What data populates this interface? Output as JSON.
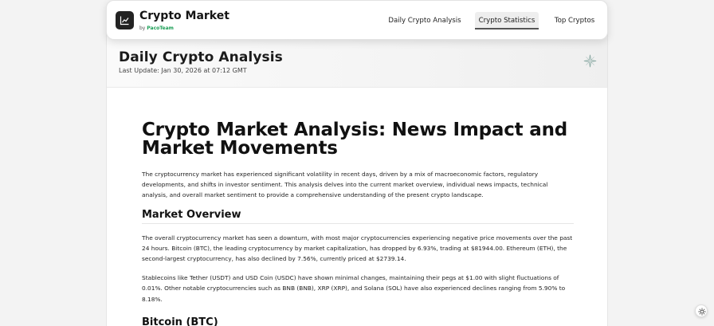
{
  "header": {
    "brand": "Crypto Market",
    "byline_prefix": "by",
    "byline_team": "PacoTeam",
    "logo_icon": "chart-line-icon",
    "nav": [
      {
        "label": "Daily Crypto Analysis",
        "active": false
      },
      {
        "label": "Crypto Statistics",
        "active": true
      },
      {
        "label": "Top Cryptos",
        "active": false
      }
    ]
  },
  "page": {
    "title": "Daily Crypto Analysis",
    "last_update": "Last Update: Jan 30, 2026 at 07:12 GMT",
    "decor_icon": "sparkle-icon"
  },
  "article": {
    "title": "Crypto Market Analysis: News Impact and Market Movements",
    "intro": "The cryptocurrency market has experienced significant volatility in recent days, driven by a mix of macroeconomic factors, regulatory developments, and shifts in investor sentiment. This analysis delves into the current market overview, individual news impacts, technical analysis, and overall market sentiment to provide a comprehensive understanding of the present crypto landscape.",
    "section1_title": "Market Overview",
    "section1_p1": "The overall cryptocurrency market has seen a downturn, with most major cryptocurrencies experiencing negative price movements over the past 24 hours. Bitcoin (BTC), the leading cryptocurrency by market capitalization, has dropped by 6.93%, trading at $81944.00. Ethereum (ETH), the second-largest cryptocurrency, has also declined by 7.56%, currently priced at $2739.14.",
    "section1_p2": "Stablecoins like Tether (USDT) and USD Coin (USDC) have shown minimal changes, maintaining their pegs at $1.00 with slight fluctuations of 0.01%. Other notable cryptocurrencies such as BNB (BNB), XRP (XRP), and Solana (SOL) have also experienced declines ranging from 5.90% to 8.18%.",
    "section2_title": "Bitcoin (BTC)"
  },
  "floating": {
    "settings_icon": "sun-icon"
  }
}
